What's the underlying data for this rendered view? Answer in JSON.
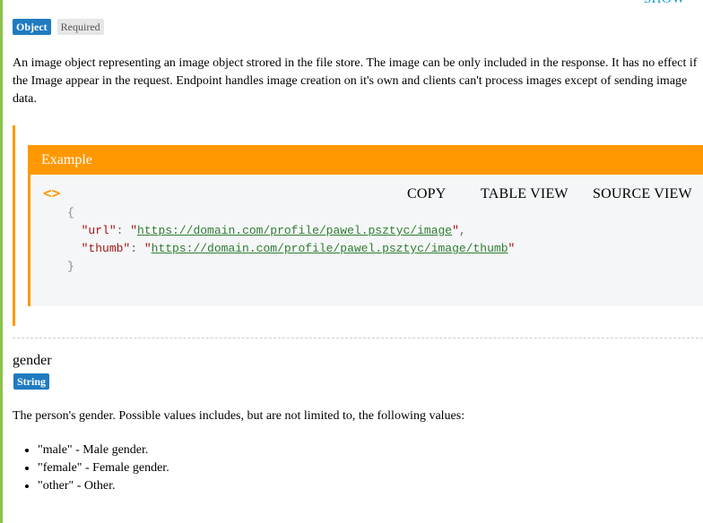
{
  "header": {
    "show_link": "SHOW"
  },
  "image_property": {
    "type_badge": "Object",
    "required_badge": "Required",
    "description": "An image object representing an image object strored in the file store. The image can be only included in the response. It has no effect if the Image appear in the request. Endpoint handles image creation on it's own and clients can't process images except of sending image data."
  },
  "example": {
    "title": "Example",
    "toolbar": {
      "toggle_icon": "code-brackets-icon",
      "toggle_glyph": "<>",
      "copy": "COPY",
      "table_view": "TABLE VIEW",
      "source_view": "SOURCE VIEW"
    },
    "code": {
      "open_brace": "{",
      "close_brace": "}",
      "url_key": "\"url\"",
      "url_value": "https://domain.com/profile/pawel.psztyc/image",
      "thumb_key": "\"thumb\"",
      "thumb_value": "https://domain.com/profile/pawel.psztyc/image/thumb"
    }
  },
  "gender_property": {
    "name": "gender",
    "type_badge": "String",
    "description": "The person's gender. Possible values includes, but are not limited to, the following values:",
    "values": [
      "\"male\" - Male gender.",
      "\"female\" - Female gender.",
      "\"other\" - Other."
    ]
  },
  "colors": {
    "accent_orange": "#ff9800",
    "badge_blue": "#1f7bc1",
    "link_blue": "#1d9ad6",
    "rail_green": "#8bc34a"
  }
}
